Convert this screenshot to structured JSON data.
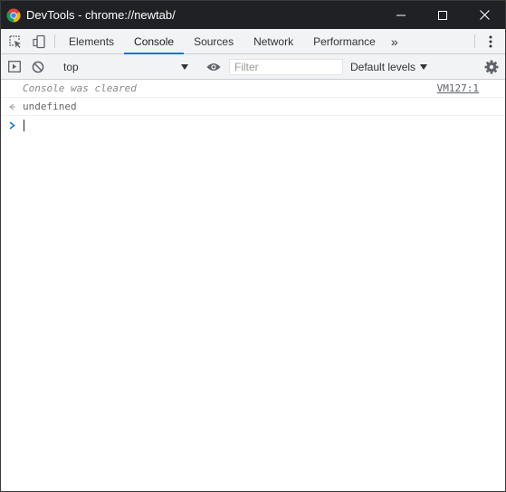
{
  "window": {
    "title": "DevTools - chrome://newtab/"
  },
  "titlebar": {
    "minimize_icon": "minimize-icon",
    "maximize_icon": "maximize-icon",
    "close_icon": "close-icon"
  },
  "tabs": {
    "items": [
      {
        "label": "Elements"
      },
      {
        "label": "Console",
        "active": true
      },
      {
        "label": "Sources"
      },
      {
        "label": "Network"
      },
      {
        "label": "Performance"
      }
    ],
    "more_label": "»"
  },
  "console_toolbar": {
    "context_value": "top",
    "filter_placeholder": "Filter",
    "levels_label": "Default levels"
  },
  "console": {
    "messages": [
      {
        "text": "Console was cleared",
        "source": "VM127:1"
      },
      {
        "text": "undefined"
      }
    ]
  },
  "colors": {
    "titlebar_bg": "#202124",
    "accent": "#1a73e8",
    "toolbar_bg": "#f1f3f4"
  }
}
